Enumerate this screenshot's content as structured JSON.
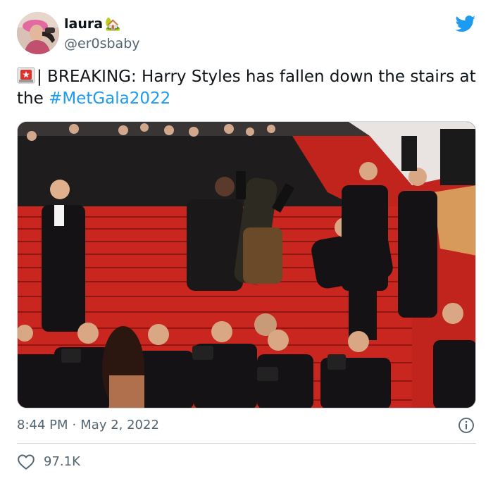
{
  "author": {
    "name": "laura",
    "name_emoji": "🏡",
    "handle": "@er0sbaby"
  },
  "tweet": {
    "text_before": "| BREAKING: Harry Styles has fallen down the stairs at the ",
    "hashtag": "#MetGala2022",
    "leading_icon": "siren-icon"
  },
  "media": {
    "icon": "photo-red-carpet-stairs"
  },
  "meta": {
    "time": "8:44 PM",
    "separator": "·",
    "date": "May 2, 2022"
  },
  "engagement": {
    "likes": "97.1K"
  },
  "colors": {
    "brand": "#1d9bf0",
    "text": "#0f1419",
    "secondary": "#536471",
    "border": "#cfd9de",
    "carpet": "#c8261f"
  }
}
